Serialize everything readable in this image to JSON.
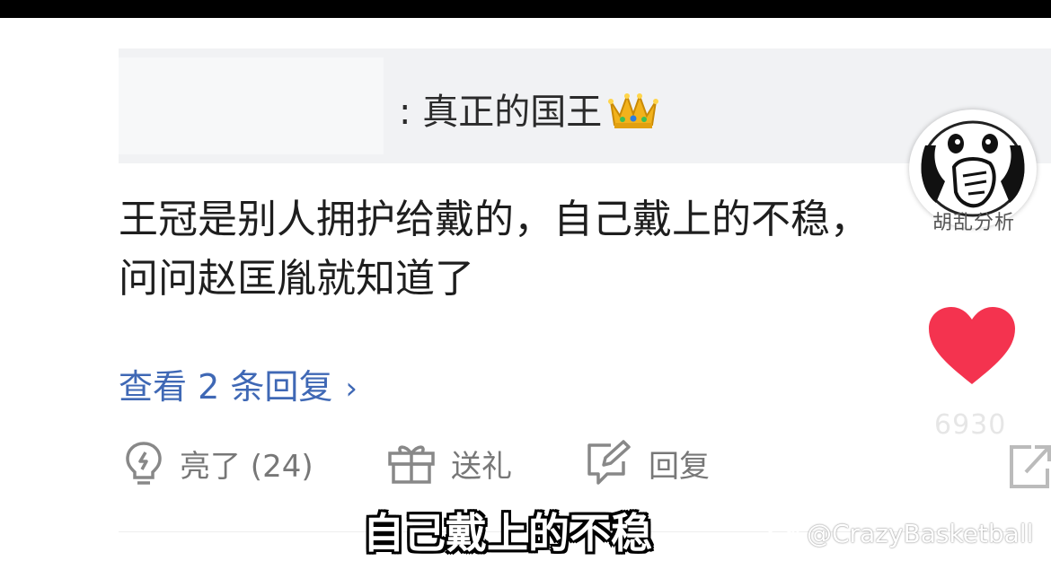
{
  "quote": {
    "text": ": 真正的国王"
  },
  "comment": {
    "text": "王冠是别人拥护给戴的，自己戴上的不稳，\n问问赵匡胤就知道了"
  },
  "replies": {
    "label": "查看 2 条回复",
    "chevron": "›"
  },
  "actions": {
    "like": {
      "label": "亮了 (24)",
      "icon": "lightbulb-icon"
    },
    "gift": {
      "label": "送礼",
      "icon": "gift-icon"
    },
    "reply": {
      "label": "回复",
      "icon": "edit-reply-icon"
    }
  },
  "sidebar": {
    "avatar_tag": "胡乱分析",
    "like_count": "6930",
    "heart_color": "#f4334f"
  },
  "subtitle": {
    "text": "自己戴上的不稳"
  },
  "watermark": {
    "text": "@CrazyBasketball",
    "icon": "weibo-icon"
  }
}
